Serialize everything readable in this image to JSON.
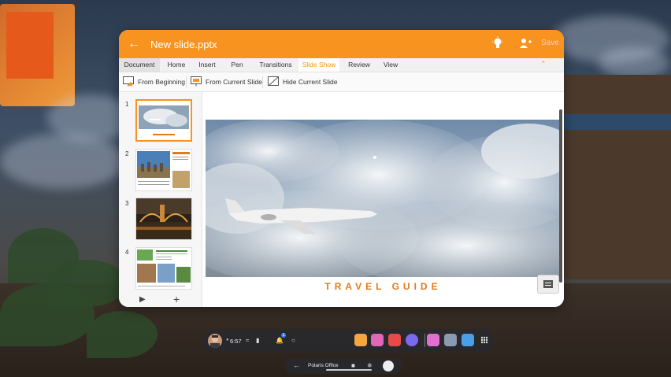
{
  "window": {
    "title": "New slide.pptx",
    "save_label": "Save",
    "accent_color": "#f7931e"
  },
  "tabs": [
    {
      "label": "Document"
    },
    {
      "label": "Home"
    },
    {
      "label": "Insert"
    },
    {
      "label": "Pen"
    },
    {
      "label": "Transitions"
    },
    {
      "label": "Slide Show"
    },
    {
      "label": "Review"
    },
    {
      "label": "View"
    }
  ],
  "active_tab": "Slide Show",
  "ribbon": {
    "from_beginning": "From Beginning",
    "from_current": "From Current Slide",
    "hide_current": "Hide Current Slide"
  },
  "thumbnails": [
    {
      "number": "1",
      "selected": true
    },
    {
      "number": "2",
      "selected": false
    },
    {
      "number": "3",
      "selected": false
    },
    {
      "number": "4",
      "selected": false
    }
  ],
  "slide": {
    "title": "TRAVEL GUIDE"
  },
  "dock": {
    "time": "6:57",
    "notification_count": "1",
    "apps": [
      "lock-app",
      "chat-app",
      "camera-app",
      "browser-app",
      "gallery-app",
      "settings-app",
      "polaris-office-app"
    ]
  },
  "taskbar": {
    "app_name": "Polaris Office"
  }
}
